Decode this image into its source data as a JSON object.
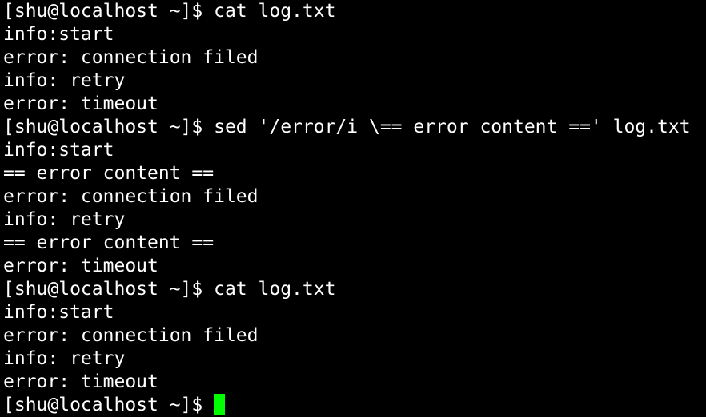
{
  "terminal": {
    "cursor_color": "#00ff00",
    "background": "#000000",
    "foreground": "#ffffff",
    "lines": [
      {
        "kind": "command",
        "prompt": "[shu@localhost ~]$ ",
        "command": "cat log.txt"
      },
      {
        "kind": "output",
        "text": "info:start"
      },
      {
        "kind": "output",
        "text": "error: connection filed"
      },
      {
        "kind": "output",
        "text": "info: retry"
      },
      {
        "kind": "output",
        "text": "error: timeout"
      },
      {
        "kind": "command",
        "prompt": "[shu@localhost ~]$ ",
        "command": "sed '/error/i \\== error content ==' log.txt"
      },
      {
        "kind": "output",
        "text": "info:start"
      },
      {
        "kind": "output",
        "text": "== error content =="
      },
      {
        "kind": "output",
        "text": "error: connection filed"
      },
      {
        "kind": "output",
        "text": "info: retry"
      },
      {
        "kind": "output",
        "text": "== error content =="
      },
      {
        "kind": "output",
        "text": "error: timeout"
      },
      {
        "kind": "command",
        "prompt": "[shu@localhost ~]$ ",
        "command": "cat log.txt"
      },
      {
        "kind": "output",
        "text": "info:start"
      },
      {
        "kind": "output",
        "text": "error: connection filed"
      },
      {
        "kind": "output",
        "text": "info: retry"
      },
      {
        "kind": "output",
        "text": "error: timeout"
      },
      {
        "kind": "prompt",
        "prompt": "[shu@localhost ~]$ ",
        "command": ""
      }
    ]
  }
}
